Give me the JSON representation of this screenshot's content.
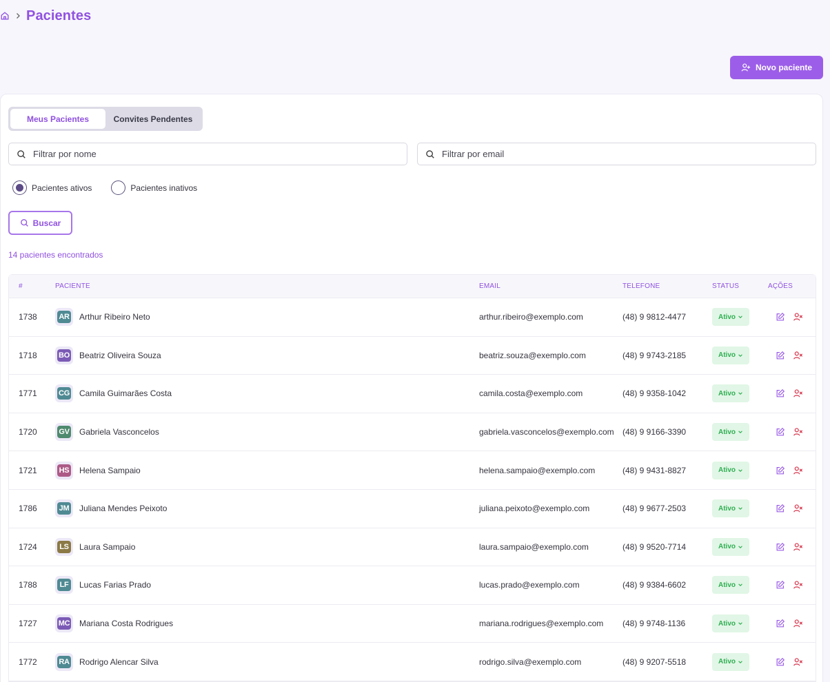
{
  "breadcrumb": {
    "title": "Pacientes"
  },
  "header": {
    "new_patient_label": "Novo paciente"
  },
  "tabs": [
    {
      "label": "Meus Pacientes",
      "active": true
    },
    {
      "label": "Convites Pendentes",
      "active": false
    }
  ],
  "filters": {
    "name_placeholder": "Filtrar por nome",
    "email_placeholder": "Filtrar por email",
    "radio_active_label": "Pacientes ativos",
    "radio_inactive_label": "Pacientes inativos",
    "search_label": "Buscar"
  },
  "results": {
    "count_text": "14 pacientes encontrados"
  },
  "table": {
    "columns": {
      "id": "#",
      "patient": "PACIENTE",
      "email": "EMAIL",
      "phone": "TELEFONE",
      "status": "STATUS",
      "actions": "AÇÕES"
    },
    "rows": [
      {
        "id": "1738",
        "initials": "AR",
        "color": "#4f8a93",
        "name": "Arthur Ribeiro Neto",
        "email": "arthur.ribeiro@exemplo.com",
        "phone": "(48) 9 9812-4477",
        "status": "Ativo"
      },
      {
        "id": "1718",
        "initials": "BO",
        "color": "#7b5bb5",
        "name": "Beatriz Oliveira Souza",
        "email": "beatriz.souza@exemplo.com",
        "phone": "(48) 9 9743-2185",
        "status": "Ativo"
      },
      {
        "id": "1771",
        "initials": "CG",
        "color": "#4f8a93",
        "name": "Camila Guimarães Costa",
        "email": "camila.costa@exemplo.com",
        "phone": "(48) 9 9358-1042",
        "status": "Ativo"
      },
      {
        "id": "1720",
        "initials": "GV",
        "color": "#4e8a6e",
        "name": "Gabriela Vasconcelos",
        "email": "gabriela.vasconcelos@exemplo.com",
        "phone": "(48) 9 9166-3390",
        "status": "Ativo"
      },
      {
        "id": "1721",
        "initials": "HS",
        "color": "#ad5a87",
        "name": "Helena Sampaio",
        "email": "helena.sampaio@exemplo.com",
        "phone": "(48) 9 9431-8827",
        "status": "Ativo"
      },
      {
        "id": "1786",
        "initials": "JM",
        "color": "#4f8a93",
        "name": "Juliana Mendes Peixoto",
        "email": "juliana.peixoto@exemplo.com",
        "phone": "(48) 9 9677-2503",
        "status": "Ativo"
      },
      {
        "id": "1724",
        "initials": "LS",
        "color": "#8b7a45",
        "name": "Laura Sampaio",
        "email": "laura.sampaio@exemplo.com",
        "phone": "(48) 9 9520-7714",
        "status": "Ativo"
      },
      {
        "id": "1788",
        "initials": "LF",
        "color": "#4f8a93",
        "name": "Lucas Farias Prado",
        "email": "lucas.prado@exemplo.com",
        "phone": "(48) 9 9384-6602",
        "status": "Ativo"
      },
      {
        "id": "1727",
        "initials": "MC",
        "color": "#7b5bb5",
        "name": "Mariana Costa Rodrigues",
        "email": "mariana.rodrigues@exemplo.com",
        "phone": "(48) 9 9748-1136",
        "status": "Ativo"
      },
      {
        "id": "1772",
        "initials": "RA",
        "color": "#4f8a93",
        "name": "Rodrigo Alencar Silva",
        "email": "rodrigo.silva@exemplo.com",
        "phone": "(48) 9 9207-5518",
        "status": "Ativo"
      }
    ]
  },
  "colors": {
    "accent": "#9c5ee8",
    "danger": "#d6334a",
    "success": "#2fae52"
  },
  "icons": [
    "home-icon",
    "chevron-right-icon",
    "user-plus-icon",
    "search-icon",
    "chevron-down-icon",
    "edit-icon",
    "user-remove-icon"
  ]
}
